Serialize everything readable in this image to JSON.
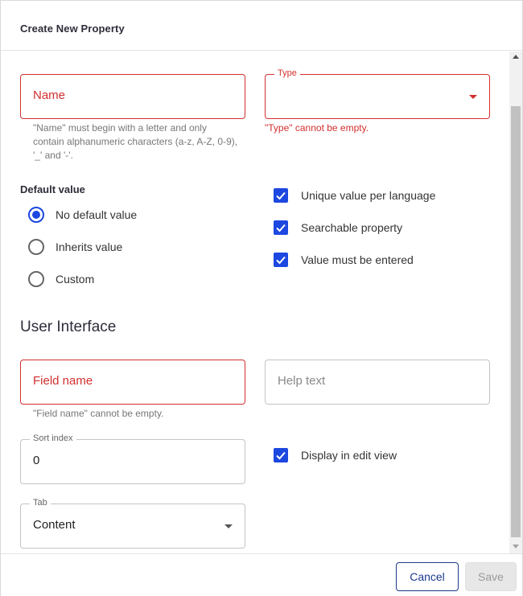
{
  "dialog": {
    "title": "Create New Property"
  },
  "name_field": {
    "placeholder": "Name",
    "helper": "\"Name\" must begin with a letter and only contain alphanumeric characters (a-z, A-Z, 0-9), '_' and '-'."
  },
  "type_field": {
    "legend": "Type",
    "value": "",
    "error": "\"Type\" cannot be empty."
  },
  "default_value": {
    "label": "Default value",
    "options": [
      {
        "label": "No default value",
        "checked": true
      },
      {
        "label": "Inherits value",
        "checked": false
      },
      {
        "label": "Custom",
        "checked": false
      }
    ]
  },
  "flags": [
    {
      "label": "Unique value per language",
      "checked": true
    },
    {
      "label": "Searchable property",
      "checked": true
    },
    {
      "label": "Value must be entered",
      "checked": true
    }
  ],
  "user_interface": {
    "heading": "User Interface",
    "field_name": {
      "placeholder": "Field name",
      "error": "\"Field name\" cannot be empty."
    },
    "help_text": {
      "placeholder": "Help text"
    },
    "sort_index": {
      "legend": "Sort index",
      "value": "0"
    },
    "display_in_edit_view": {
      "label": "Display in edit view",
      "checked": true
    },
    "tab": {
      "legend": "Tab",
      "value": "Content"
    }
  },
  "footer": {
    "cancel_label": "Cancel",
    "save_label": "Save"
  },
  "colors": {
    "accent": "#1c47e0",
    "error": "#d32f2f",
    "cancel_border": "#1a3a8f"
  }
}
